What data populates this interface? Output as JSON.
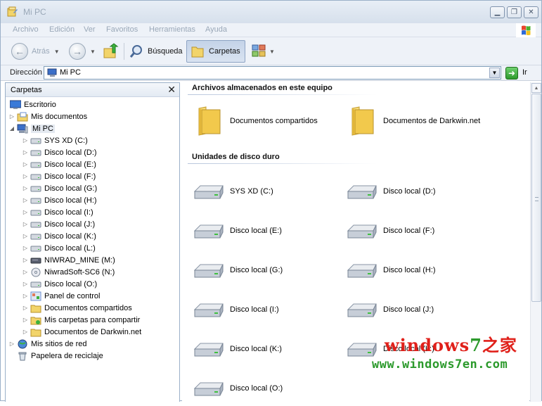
{
  "window": {
    "title": "Mi PC",
    "buttons": [
      "minimize",
      "maximize",
      "close"
    ]
  },
  "menu": [
    "Archivo",
    "Edición",
    "Ver",
    "Favoritos",
    "Herramientas",
    "Ayuda"
  ],
  "toolbar": {
    "back_label": "Atrás",
    "search_label": "Búsqueda",
    "folders_label": "Carpetas"
  },
  "address": {
    "label": "Dirección",
    "value": "Mi PC",
    "go_label": "Ir"
  },
  "folders_pane": {
    "title": "Carpetas",
    "items": [
      {
        "label": "Escritorio",
        "icon": "desktop-icon",
        "level": 0,
        "expander": ""
      },
      {
        "label": "Mis documentos",
        "icon": "my-documents-icon",
        "level": 1,
        "expander": "▷"
      },
      {
        "label": "Mi PC",
        "icon": "my-computer-icon",
        "level": 1,
        "expander": "◢",
        "selected": true
      },
      {
        "label": "SYS XD (C:)",
        "icon": "drive-icon",
        "level": 2,
        "expander": "▷"
      },
      {
        "label": "Disco local (D:)",
        "icon": "drive-icon",
        "level": 2,
        "expander": "▷"
      },
      {
        "label": "Disco local (E:)",
        "icon": "drive-icon",
        "level": 2,
        "expander": "▷"
      },
      {
        "label": "Disco local (F:)",
        "icon": "drive-icon",
        "level": 2,
        "expander": "▷"
      },
      {
        "label": "Disco local (G:)",
        "icon": "drive-icon",
        "level": 2,
        "expander": "▷"
      },
      {
        "label": "Disco local (H:)",
        "icon": "drive-icon",
        "level": 2,
        "expander": "▷"
      },
      {
        "label": "Disco local (I:)",
        "icon": "drive-icon",
        "level": 2,
        "expander": "▷"
      },
      {
        "label": "Disco local (J:)",
        "icon": "drive-icon",
        "level": 2,
        "expander": "▷"
      },
      {
        "label": "Disco local (K:)",
        "icon": "drive-icon",
        "level": 2,
        "expander": "▷"
      },
      {
        "label": "Disco local (L:)",
        "icon": "drive-icon",
        "level": 2,
        "expander": "▷"
      },
      {
        "label": "NIWRAD_MINE (M:)",
        "icon": "removable-drive-icon",
        "level": 2,
        "expander": "▷"
      },
      {
        "label": "NiwradSoft-SC6 (N:)",
        "icon": "cd-drive-icon",
        "level": 2,
        "expander": "▷"
      },
      {
        "label": "Disco local (O:)",
        "icon": "drive-icon",
        "level": 2,
        "expander": "▷"
      },
      {
        "label": "Panel de control",
        "icon": "control-panel-icon",
        "level": 2,
        "expander": "▷"
      },
      {
        "label": "Documentos compartidos",
        "icon": "folder-icon",
        "level": 2,
        "expander": "▷"
      },
      {
        "label": "Mis carpetas para compartir",
        "icon": "shared-folder-icon",
        "level": 2,
        "expander": "▷"
      },
      {
        "label": "Documentos de Darkwin.net",
        "icon": "folder-icon",
        "level": 2,
        "expander": "▷"
      },
      {
        "label": "Mis sitios de red",
        "icon": "network-places-icon",
        "level": 1,
        "expander": "▷"
      },
      {
        "label": "Papelera de reciclaje",
        "icon": "recycle-bin-icon",
        "level": 1,
        "expander": ""
      }
    ]
  },
  "content": {
    "groups": [
      {
        "title": "Archivos almacenados en este equipo",
        "items": [
          {
            "label": "Documentos compartidos",
            "icon": "folder-icon"
          },
          {
            "label": "Documentos de Darkwin.net",
            "icon": "folder-icon"
          }
        ]
      },
      {
        "title": "Unidades de disco duro",
        "items": [
          {
            "label": "SYS XD (C:)",
            "icon": "hard-drive-icon"
          },
          {
            "label": "Disco local (D:)",
            "icon": "hard-drive-icon"
          },
          {
            "label": "Disco local (E:)",
            "icon": "hard-drive-icon"
          },
          {
            "label": "Disco local (F:)",
            "icon": "hard-drive-icon"
          },
          {
            "label": "Disco local (G:)",
            "icon": "hard-drive-icon"
          },
          {
            "label": "Disco local (H:)",
            "icon": "hard-drive-icon"
          },
          {
            "label": "Disco local (I:)",
            "icon": "hard-drive-icon"
          },
          {
            "label": "Disco local (J:)",
            "icon": "hard-drive-icon"
          },
          {
            "label": "Disco local (K:)",
            "icon": "hard-drive-icon"
          },
          {
            "label": "Disco local (L:)",
            "icon": "hard-drive-icon"
          },
          {
            "label": "Disco local (O:)",
            "icon": "hard-drive-icon"
          }
        ]
      }
    ]
  },
  "watermark": {
    "line1_a": "windows",
    "line1_b": "7",
    "line1_c": "之家",
    "line2": "www.windows7en.com"
  },
  "colors": {
    "selection": "#e4e9f0",
    "folder": "#f2c94c",
    "watermark_red": "#e0201a",
    "watermark_green": "#2c9a2c",
    "watermark_blue": "#2a5fc8"
  }
}
